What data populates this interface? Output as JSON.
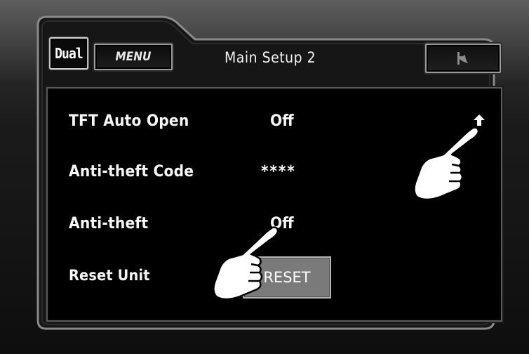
{
  "header": {
    "logo_text": "Dual",
    "menu_label": "MENU",
    "title": "Main Setup 2",
    "back_icon": "back-arrow-icon"
  },
  "settings": [
    {
      "label": "TFT Auto Open",
      "value": "Off"
    },
    {
      "label": "Anti-theft Code",
      "value": "****"
    },
    {
      "label": "Anti-theft",
      "value": "Off"
    },
    {
      "label": "Reset Unit",
      "button": "RESET"
    }
  ],
  "icons": {
    "scroll_up": "up-arrow-icon",
    "pointer_1": "pointing-hand-icon",
    "pointer_2": "pointing-hand-icon"
  },
  "colors": {
    "screen_bg": "#000000",
    "bezel": "#1b1b1b",
    "button_gray": "#7a7a7a",
    "text": "#f5f5f5"
  }
}
